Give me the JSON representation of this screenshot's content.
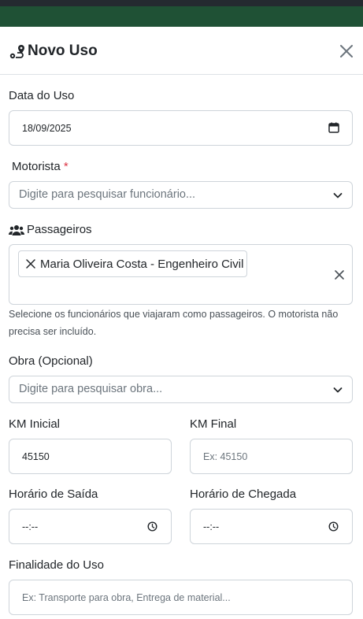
{
  "modal": {
    "title": "Novo Uso",
    "title_icon": "route-icon",
    "close_icon": "close-icon"
  },
  "form": {
    "data_uso": {
      "label": "Data do Uso",
      "value": "18/09/2025"
    },
    "motorista": {
      "label": "Motorista",
      "required_mark": "*",
      "placeholder": "Digite para pesquisar funcionário..."
    },
    "passageiros": {
      "label": "Passageiros",
      "icon": "users-icon",
      "selected": [
        "Maria Oliveira Costa - Engenheiro Civil"
      ],
      "help": "Selecione os funcionários que viajaram como passageiros. O motorista não precisa ser incluído."
    },
    "obra": {
      "label": "Obra (Opcional)",
      "placeholder": "Digite para pesquisar obra..."
    },
    "km_inicial": {
      "label": "KM Inicial",
      "value": "45150"
    },
    "km_final": {
      "label": "KM Final",
      "placeholder": "Ex: 45150"
    },
    "horario_saida": {
      "label": "Horário de Saída",
      "value": "--:--"
    },
    "horario_chegada": {
      "label": "Horário de Chegada",
      "value": "--:--"
    },
    "finalidade": {
      "label": "Finalidade do Uso",
      "placeholder": "Ex: Transporte para obra, Entrega de material..."
    }
  }
}
